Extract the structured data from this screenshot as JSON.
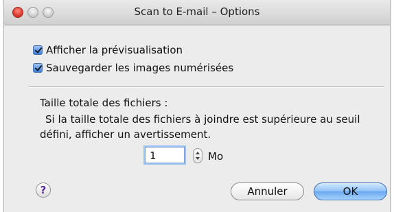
{
  "window": {
    "title": "Scan to E-mail – Options"
  },
  "options": {
    "show_preview": {
      "label": "Afficher la prévisualisation",
      "checked": true
    },
    "save_images": {
      "label": "Sauvegarder les images numérisées",
      "checked": true
    }
  },
  "file_size": {
    "heading": "Taille totale des fichiers :",
    "description_line1": "Si la taille totale des fichiers à joindre est supérieure au seuil",
    "description_line2": "défini, afficher un avertissement.",
    "value": "1",
    "unit": "Mo"
  },
  "buttons": {
    "help": "?",
    "cancel": "Annuler",
    "ok": "OK"
  },
  "colors": {
    "close_button": "#d8342a",
    "default_button": "#6aa8ef",
    "window_background": "#ececec"
  }
}
